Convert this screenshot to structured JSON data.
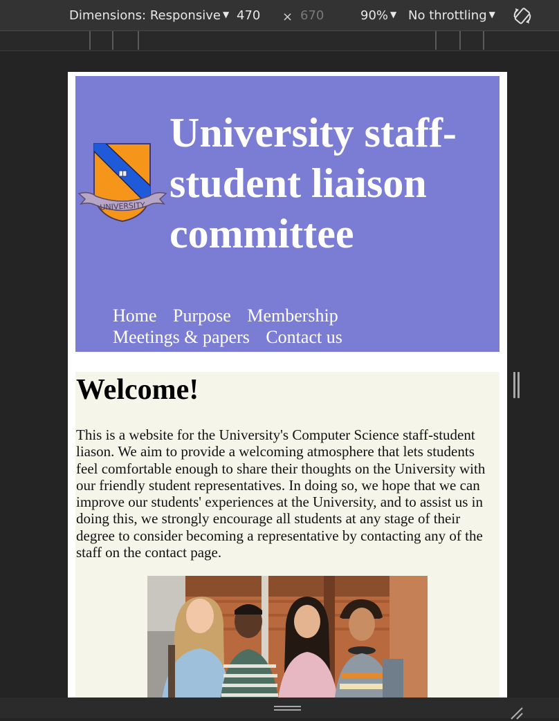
{
  "devtools": {
    "dimensions_label": "Dimensions: Responsive",
    "width_value": "470",
    "times_symbol": "×",
    "height_value": "670",
    "zoom": "90%",
    "throttling": "No throttling"
  },
  "site": {
    "title": "University staff-student liaison committee",
    "logo_text": "UNIVERSITY",
    "nav": [
      "Home",
      "Purpose",
      "Membership",
      "Meetings & papers",
      "Contact us"
    ],
    "welcome_heading": "Welcome!",
    "intro_paragraph": "This is a website for the University's Computer Science staff-student liason. We aim to provide a welcoming atmosphere that lets students feel comfortable enough to share their thoughts on the University with our friendly student representatives. In doing so, we hope that we can improve our students' experiences at the University, and to assist us in doing this, we strongly encourage all students at any stage of their degree to consider becoming a representative by contacting any of the staff on the contact page."
  },
  "colors": {
    "header_bg": "#7b7dd4",
    "content_bg": "#f6f5ea",
    "shield_orange": "#f5961a",
    "shield_stripe": "#1f5bd8"
  }
}
